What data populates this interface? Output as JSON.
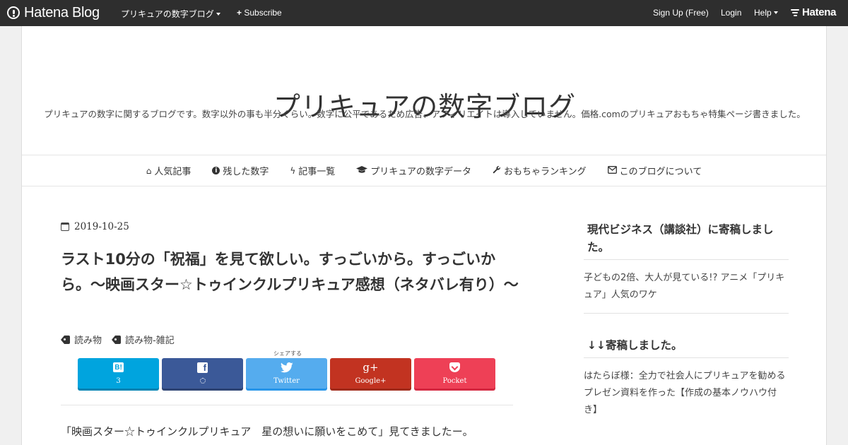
{
  "topbar": {
    "brand": "Hatena Blog",
    "blog_menu": "プリキュアの数字ブログ",
    "subscribe": "Subscribe",
    "signup": "Sign Up (Free)",
    "login": "Login",
    "help": "Help",
    "hatena": "Hatena"
  },
  "blog": {
    "title": "プリキュアの数字ブログ",
    "description": "プリキュアの数字に関するブログです。数字以外の事も半分くらい。数字に公平であるため広告、アフィリエイトは導入していません。価格.comのプリキュアおもちゃ特集ページ書きました。"
  },
  "nav": [
    {
      "icon": "home-icon",
      "label": "人気記事"
    },
    {
      "icon": "info-circle-icon",
      "label": "残した数字"
    },
    {
      "icon": "bolt-icon",
      "label": "記事一覧"
    },
    {
      "icon": "graduation-cap-icon",
      "label": "プリキュアの数字データ"
    },
    {
      "icon": "wrench-icon",
      "label": "おもちゃランキング"
    },
    {
      "icon": "envelope-icon",
      "label": "このブログについて"
    }
  ],
  "entry": {
    "date": "2019-10-25",
    "title": "ラスト10分の「祝福」を見て欲しい。すっごいから。すっごいから。～映画スター☆トゥインクルプリキュア感想（ネタバレ有り）～",
    "categories": [
      "読み物",
      "読み物-雑記"
    ],
    "share_caption": "シェアする",
    "body_first_line": "「映画スター☆トゥインクルプリキュア　星の想いに願いをこめて」見てきましたー。"
  },
  "share_buttons": [
    {
      "name": "hatena-bookmark",
      "icon_text": "B!",
      "label": "3",
      "color": "#00a4de"
    },
    {
      "name": "facebook",
      "icon_text": "f",
      "label": "",
      "color": "#3b5998"
    },
    {
      "name": "twitter",
      "icon_text": "",
      "label": "Twitter",
      "color": "#55acee"
    },
    {
      "name": "google-plus",
      "icon_text": "g+",
      "label": "Google+",
      "color": "#dd4b39"
    },
    {
      "name": "pocket",
      "icon_text": "",
      "label": "Pocket",
      "color": "#ee4056"
    }
  ],
  "sidebar": {
    "modules": [
      {
        "title": "現代ビジネス（講談社）に寄稿しました。",
        "body": "子どもの2倍、大人が見ている!? アニメ「プリキュア」人気のワケ"
      },
      {
        "title": "↓↓寄稿しました。",
        "body": "はたらぼ様：全力で社会人にプリキュアを勧めるプレゼン資料を作った【作成の基本ノウハウ付き】"
      }
    ]
  },
  "colors": {
    "topbar_bg": "#2e2e2e",
    "page_bg": "#f0f0f0"
  }
}
